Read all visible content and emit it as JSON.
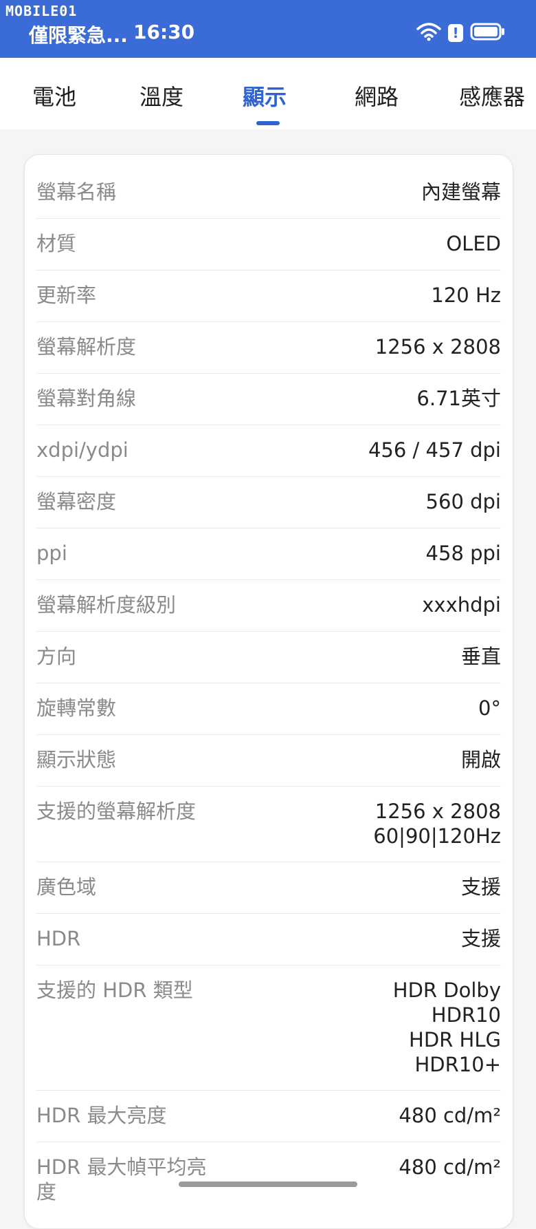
{
  "watermark": "MOBILE01",
  "status_bar": {
    "carrier": "僅限緊急...",
    "time": "16:30",
    "wifi_icon": "wifi-icon",
    "alert_icon": "alert-icon",
    "battery_icon": "battery-icon",
    "alert_text": "!"
  },
  "tabs": [
    {
      "label": "電池",
      "active": false
    },
    {
      "label": "溫度",
      "active": false
    },
    {
      "label": "顯示",
      "active": true
    },
    {
      "label": "網路",
      "active": false
    },
    {
      "label": "感應器",
      "active": false
    }
  ],
  "colors": {
    "status_bar": "#3a6bd6",
    "accent": "#2f63cf"
  },
  "rows": [
    {
      "label": "螢幕名稱",
      "value": "內建螢幕"
    },
    {
      "label": "材質",
      "value": "OLED"
    },
    {
      "label": "更新率",
      "value": "120 Hz"
    },
    {
      "label": "螢幕解析度",
      "value": "1256 x 2808"
    },
    {
      "label": "螢幕對角線",
      "value": "6.71英寸"
    },
    {
      "label": "xdpi/ydpi",
      "value": "456 / 457 dpi"
    },
    {
      "label": "螢幕密度",
      "value": "560 dpi"
    },
    {
      "label": "ppi",
      "value": "458 ppi"
    },
    {
      "label": "螢幕解析度級別",
      "value": "xxxhdpi"
    },
    {
      "label": "方向",
      "value": "垂直"
    },
    {
      "label": "旋轉常數",
      "value": "0°"
    },
    {
      "label": "顯示狀態",
      "value": "開啟"
    },
    {
      "label": "支援的螢幕解析度",
      "value": "1256 x 2808\n60|90|120Hz"
    },
    {
      "label": "廣色域",
      "value": "支援"
    },
    {
      "label": "HDR",
      "value": "支援"
    },
    {
      "label": "支援的 HDR 類型",
      "value": "HDR Dolby\nHDR10\nHDR HLG\nHDR10+"
    },
    {
      "label": "HDR 最大亮度",
      "value": "480 cd/m²"
    },
    {
      "label": "HDR 最大幀平均亮\n度",
      "value": "480 cd/m²"
    }
  ]
}
